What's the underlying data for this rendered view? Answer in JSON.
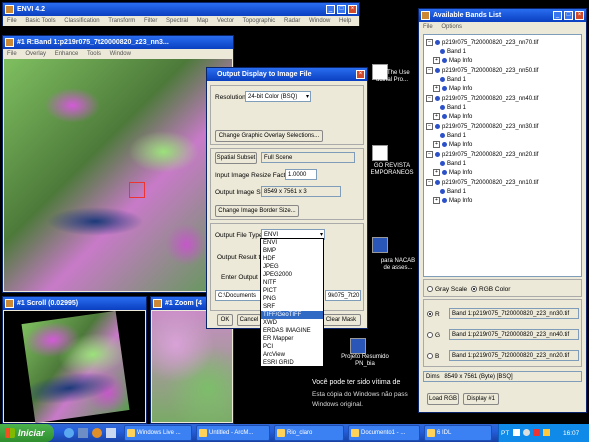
{
  "envi_main": {
    "title": "ENVI 4.2",
    "menu": [
      "File",
      "Basic Tools",
      "Classification",
      "Transform",
      "Filter",
      "Spectral",
      "Map",
      "Vector",
      "Topographic",
      "Radar",
      "Window",
      "Help"
    ]
  },
  "image_window": {
    "title": "#1 R:Band 1:p219r075_7t20000820_z23_nn3...",
    "menu": [
      "File",
      "Overlay",
      "Enhance",
      "Tools",
      "Window"
    ]
  },
  "scroll_window": {
    "title": "#1 Scroll (0.02995)"
  },
  "zoom_window": {
    "title": "#1 Zoom [4"
  },
  "dialog": {
    "title": "Output Display to Image File",
    "resolution_label": "Resolution",
    "resolution_value": "24-bit Color (BSQ)",
    "overlay_button": "Change Graphic Overlay Selections...",
    "spatial_subset_button": "Spatial Subset",
    "spatial_subset_value": "Full Scene",
    "resize_label": "Input Image Resize Factor",
    "resize_value": "1.0000",
    "size_label": "Output Image Size",
    "size_value": "8549 x 7561 x 3",
    "border_button": "Change Image Border Size...",
    "file_type_label": "Output File Type",
    "file_type_value": "ENVI",
    "output_result_label": "Output Result to",
    "enter_file_label": "Enter Output Fil",
    "path_value": "C:\\Documents",
    "path_tail": "9k075_7t20",
    "ok_button": "OK",
    "cancel_button": "Cancel",
    "clear_mask_button": "Clear Mask",
    "file_type_options": [
      "ENVI",
      "BMP",
      "HDF",
      "JPEG",
      "JPEG2000",
      "NITF",
      "PICT",
      "PNG",
      "SRF",
      "TIFF/GeoTIFF",
      "XWD",
      "ERDAS IMAGINE",
      "ER Mapper",
      "PCI",
      "ArcView",
      "ESRI GRID"
    ],
    "selected_option": "TIFF/GeoTIFF"
  },
  "bands_list": {
    "title": "Available Bands List",
    "menu": [
      "File",
      "Options"
    ],
    "files": [
      {
        "name": "p219r075_7t20000820_z23_nn70.tif",
        "band": "Band 1",
        "map": "Map Info"
      },
      {
        "name": "p219r075_7t20000820_z23_nn50.tif",
        "band": "Band 1",
        "map": "Map Info"
      },
      {
        "name": "p219r075_7t20000820_z23_nn40.tif",
        "band": "Band 1",
        "map": "Map Info"
      },
      {
        "name": "p219r075_7t20000820_z23_nn30.tif",
        "band": "Band 1",
        "map": "Map Info"
      },
      {
        "name": "p219r075_7t20000820_z23_nn20.tif",
        "band": "Band 1",
        "map": "Map Info"
      },
      {
        "name": "p219r075_7t20000820_z23_nn10.tif",
        "band": "Band 1",
        "map": "Map Info"
      }
    ],
    "gray_scale": "Gray Scale",
    "rgb_color": "RGB Color",
    "r_label": "R",
    "g_label": "G",
    "b_label": "B",
    "r_value": "Band 1:p219r075_7t20000820_z23_nn30.tif",
    "g_value": "Band 1:p219r075_7t20000820_z23_nn40.tif",
    "b_value": "Band 1:p219r075_7t20000820_z23_nn20.tif",
    "dims_label": "Dims",
    "dims_value": "8549 x 7561 (Byte) [BSQ]",
    "load_button": "Load RGB",
    "display_button": "Display #1"
  },
  "desktop": {
    "icon1_label": "GO_The Use\nudinal Pro...",
    "icon2_label": "GO REVISTA\nEMPORANEOS",
    "icon3_label": "para NACAB\nde asses...",
    "icon4_label": "Projeto Resumido\nPN_bia",
    "watermark_line1": "Você pode ter sido vítima de",
    "watermark_line2": "Esta cópia do Windows não pass",
    "watermark_line3": "Windows original."
  },
  "taskbar": {
    "start": "Iniciar",
    "items": [
      "Windows Live ...",
      "Untitled - ArcM...",
      "Rio_claro",
      "Documento1 - ...",
      "6 IDL"
    ],
    "lang": "PT",
    "clock": "16:07"
  }
}
